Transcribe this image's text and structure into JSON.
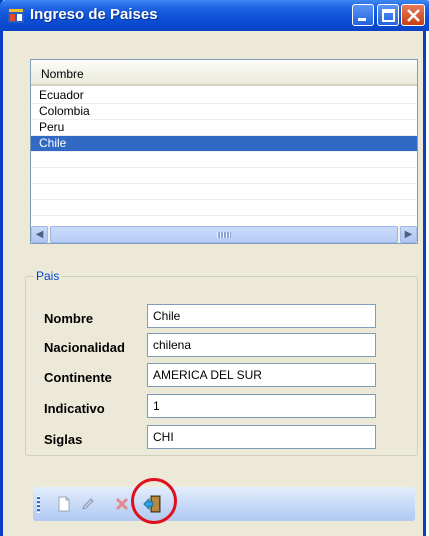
{
  "window": {
    "title": "Ingreso de Paises"
  },
  "list": {
    "column_header": "Nombre",
    "rows": [
      "Ecuador",
      "Colombia",
      "Peru",
      "Chile"
    ],
    "selected_row": "Chile"
  },
  "form": {
    "group_label": "Pais",
    "fields": [
      {
        "label": "Nombre",
        "value": "Chile"
      },
      {
        "label": "Nacionalidad",
        "value": "chilena"
      },
      {
        "label": "Continente",
        "value": "AMERICA DEL SUR"
      },
      {
        "label": "Indicativo",
        "value": "1"
      },
      {
        "label": "Siglas",
        "value": "CHI"
      }
    ]
  },
  "toolbar": {
    "icons": [
      "new-document-icon",
      "edit-pencil-icon",
      "delete-x-icon",
      "exit-door-icon"
    ],
    "highlight_color": "#e0101a"
  },
  "colors": {
    "title_bar": "#0a44c5",
    "selection": "#316ac5",
    "group_label": "#0046d5"
  }
}
